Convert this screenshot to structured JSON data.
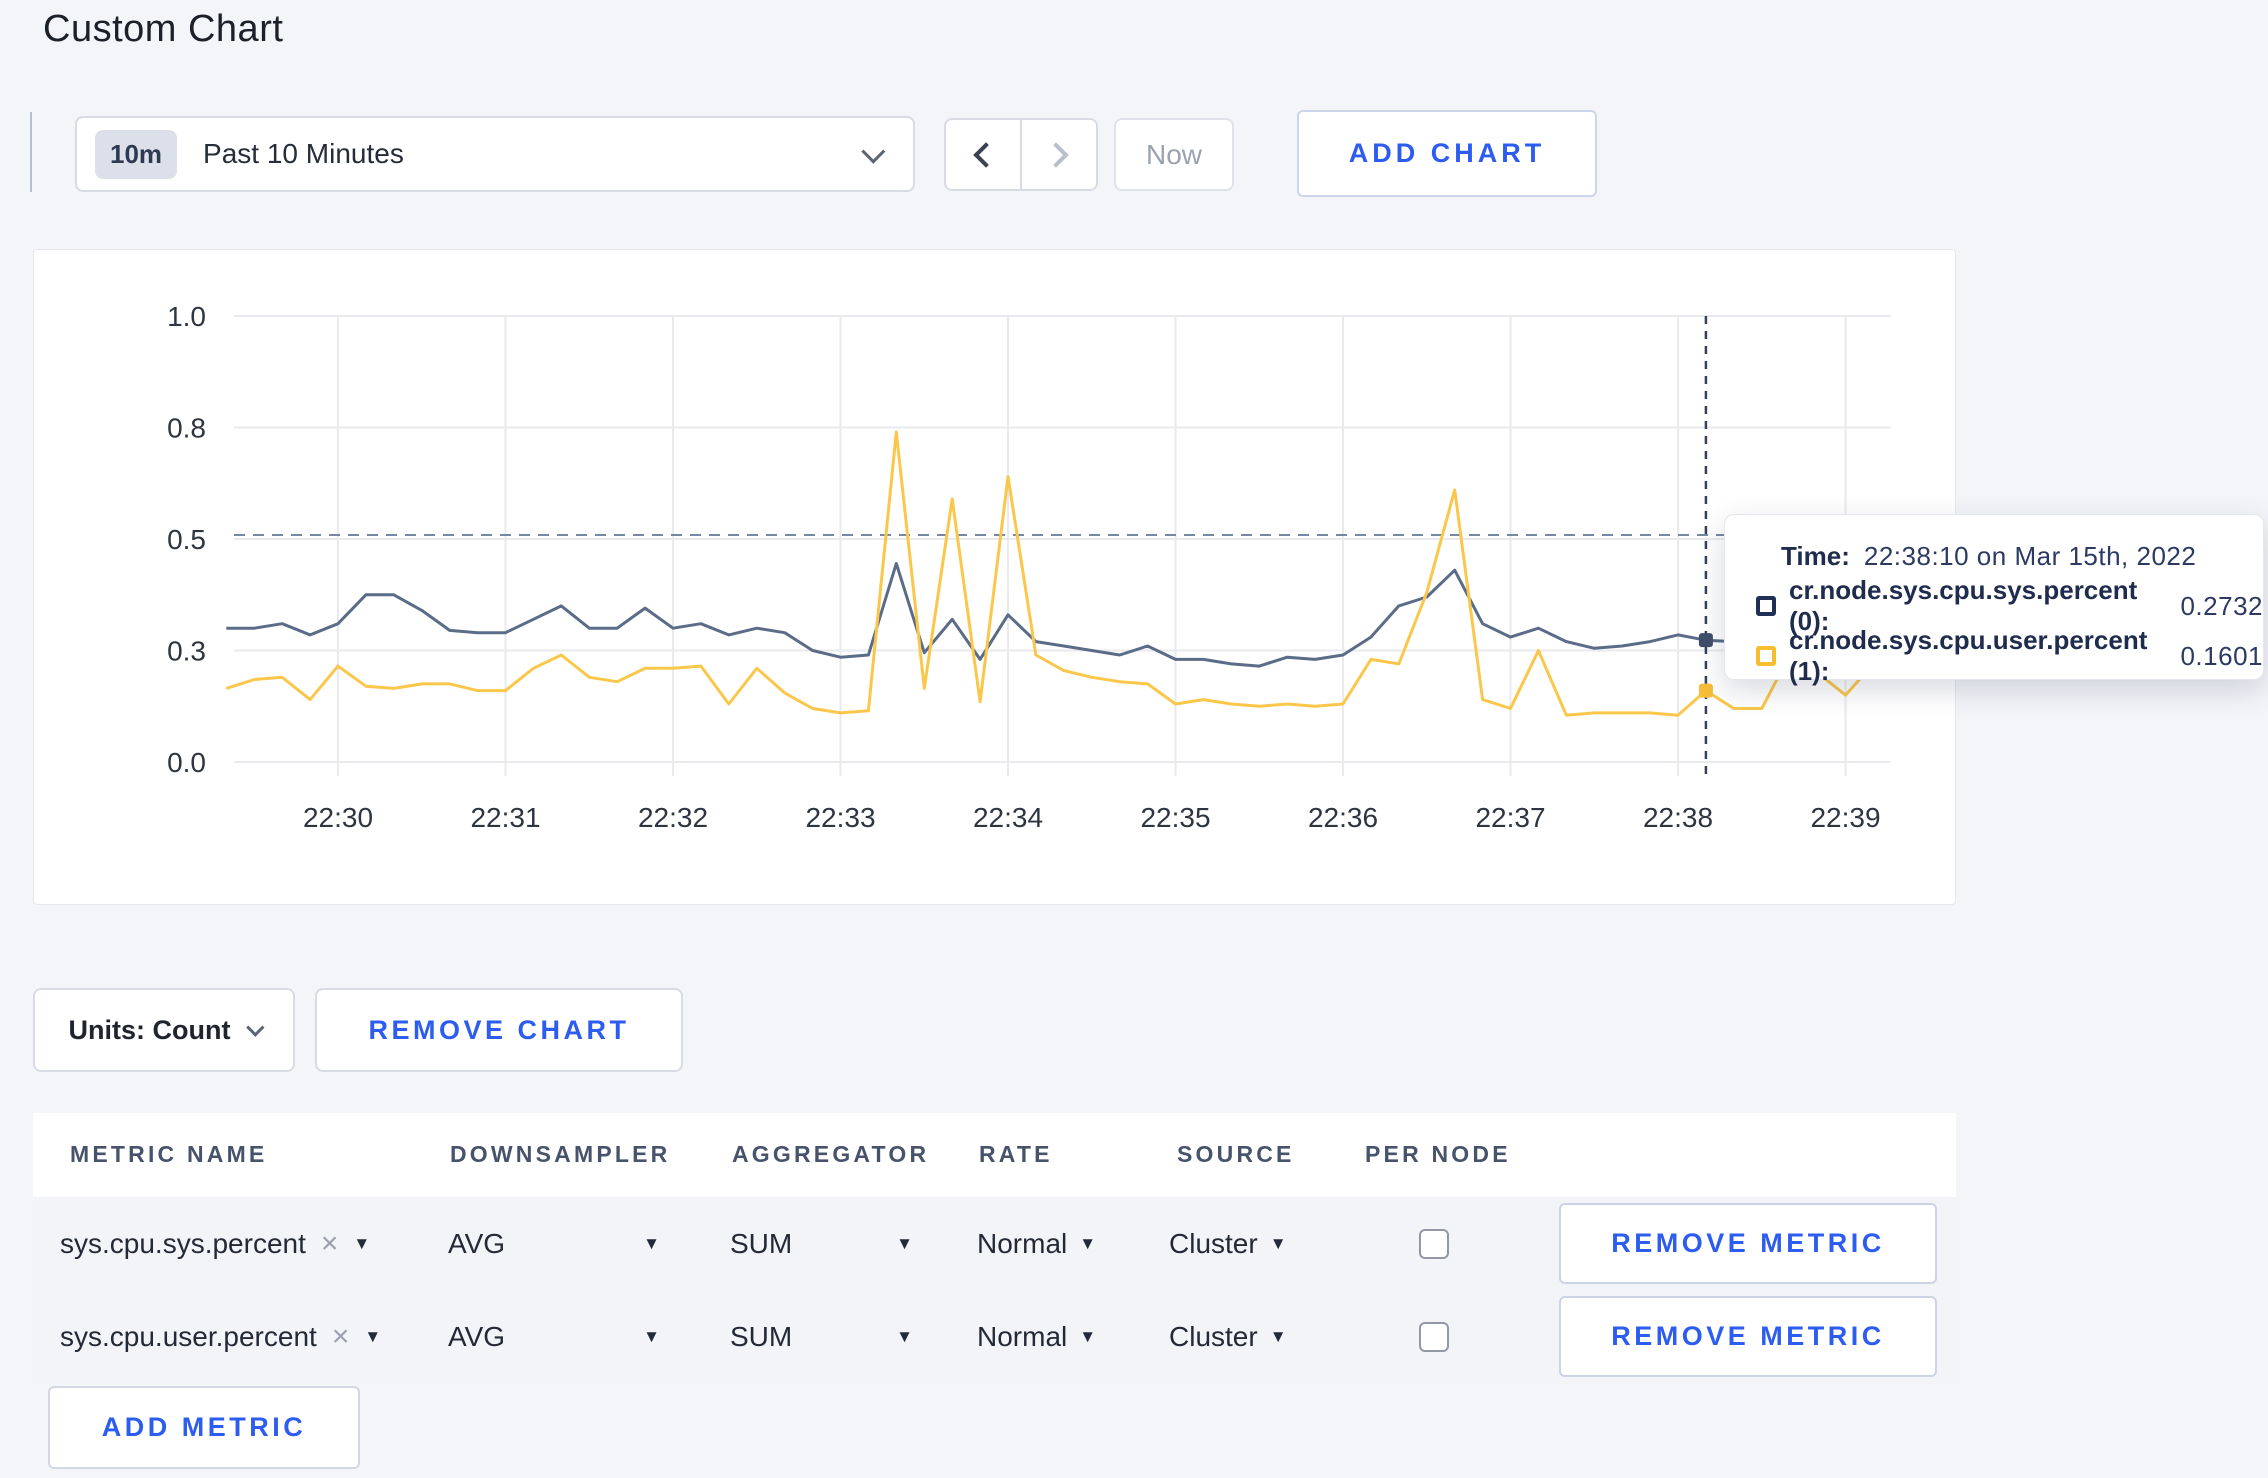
{
  "page": {
    "title": "Custom Chart",
    "background": "#f4f5f9"
  },
  "toolbar": {
    "time_window_badge": "10m",
    "time_window_label": "Past 10 Minutes",
    "now_label": "Now",
    "add_chart_label": "ADD CHART"
  },
  "units_bar": {
    "units_label": "Units: Count",
    "remove_chart_label": "REMOVE CHART"
  },
  "tooltip": {
    "time_label": "Time:",
    "time_value": "22:38:10 on Mar 15th, 2022",
    "rows": [
      {
        "label": "cr.node.sys.cpu.sys.percent (0):",
        "value": "0.2732",
        "color": "#222f55"
      },
      {
        "label": "cr.node.sys.cpu.user.percent (1):",
        "value": "0.1601",
        "color": "#f5bd2f"
      }
    ]
  },
  "chart_data": {
    "type": "line",
    "title": "",
    "xlabel": "",
    "ylabel": "",
    "ylim": [
      0,
      1
    ],
    "grid": true,
    "x_ticks": [
      "22:30",
      "22:31",
      "22:32",
      "22:33",
      "22:34",
      "22:35",
      "22:36",
      "22:37",
      "22:38",
      "22:39"
    ],
    "y_ticks": [
      {
        "label": "0.0",
        "value": 0
      },
      {
        "label": "0.3",
        "value": 0.25
      },
      {
        "label": "0.5",
        "value": 0.5
      },
      {
        "label": "0.8",
        "value": 0.75
      },
      {
        "label": "1.0",
        "value": 1.0
      }
    ],
    "start_time": "22:29:20",
    "step_seconds": 10,
    "series": [
      {
        "name": "cr.node.sys.cpu.sys.percent",
        "color": "#5a6c88",
        "values": [
          0.3,
          0.3,
          0.31,
          0.285,
          0.31,
          0.375,
          0.375,
          0.34,
          0.295,
          0.29,
          0.29,
          0.32,
          0.35,
          0.3,
          0.3,
          0.345,
          0.3,
          0.31,
          0.285,
          0.3,
          0.29,
          0.25,
          0.235,
          0.24,
          0.445,
          0.245,
          0.32,
          0.23,
          0.33,
          0.27,
          0.26,
          0.25,
          0.24,
          0.26,
          0.23,
          0.23,
          0.22,
          0.215,
          0.235,
          0.23,
          0.24,
          0.28,
          0.35,
          0.37,
          0.43,
          0.31,
          0.28,
          0.3,
          0.27,
          0.255,
          0.26,
          0.27,
          0.285,
          0.2732,
          0.27,
          0.28,
          0.29,
          0.285,
          0.28,
          0.295
        ]
      },
      {
        "name": "cr.node.sys.cpu.user.percent",
        "color": "#fbc74b",
        "values": [
          0.165,
          0.185,
          0.19,
          0.14,
          0.215,
          0.17,
          0.165,
          0.175,
          0.175,
          0.16,
          0.16,
          0.21,
          0.24,
          0.19,
          0.18,
          0.21,
          0.21,
          0.215,
          0.13,
          0.21,
          0.155,
          0.12,
          0.11,
          0.115,
          0.74,
          0.165,
          0.59,
          0.135,
          0.64,
          0.24,
          0.205,
          0.19,
          0.18,
          0.175,
          0.13,
          0.14,
          0.13,
          0.125,
          0.13,
          0.125,
          0.13,
          0.23,
          0.22,
          0.38,
          0.61,
          0.14,
          0.12,
          0.25,
          0.105,
          0.11,
          0.11,
          0.11,
          0.105,
          0.1601,
          0.12,
          0.12,
          0.24,
          0.2,
          0.15,
          0.22
        ]
      }
    ],
    "crosshair": {
      "time": "22:38:10",
      "hline_value": 0.509,
      "points": [
        {
          "series": 0,
          "value": 0.2732,
          "color": "#3f4f6b"
        },
        {
          "series": 1,
          "value": 0.1601,
          "color": "#f7bd3a"
        }
      ]
    },
    "legend_position": "tooltip"
  },
  "metrics_table": {
    "columns": [
      "METRIC NAME",
      "DOWNSAMPLER",
      "AGGREGATOR",
      "RATE",
      "SOURCE",
      "PER NODE"
    ],
    "rows": [
      {
        "metric": "sys.cpu.sys.percent",
        "remove": "×",
        "downsampler": "AVG",
        "aggregator": "SUM",
        "rate": "Normal",
        "source": "Cluster",
        "per_node_checked": false,
        "remove_label": "REMOVE METRIC"
      },
      {
        "metric": "sys.cpu.user.percent",
        "remove": "×",
        "downsampler": "AVG",
        "aggregator": "SUM",
        "rate": "Normal",
        "source": "Cluster",
        "per_node_checked": false,
        "remove_label": "REMOVE METRIC"
      }
    ],
    "add_metric_label": "ADD METRIC"
  }
}
